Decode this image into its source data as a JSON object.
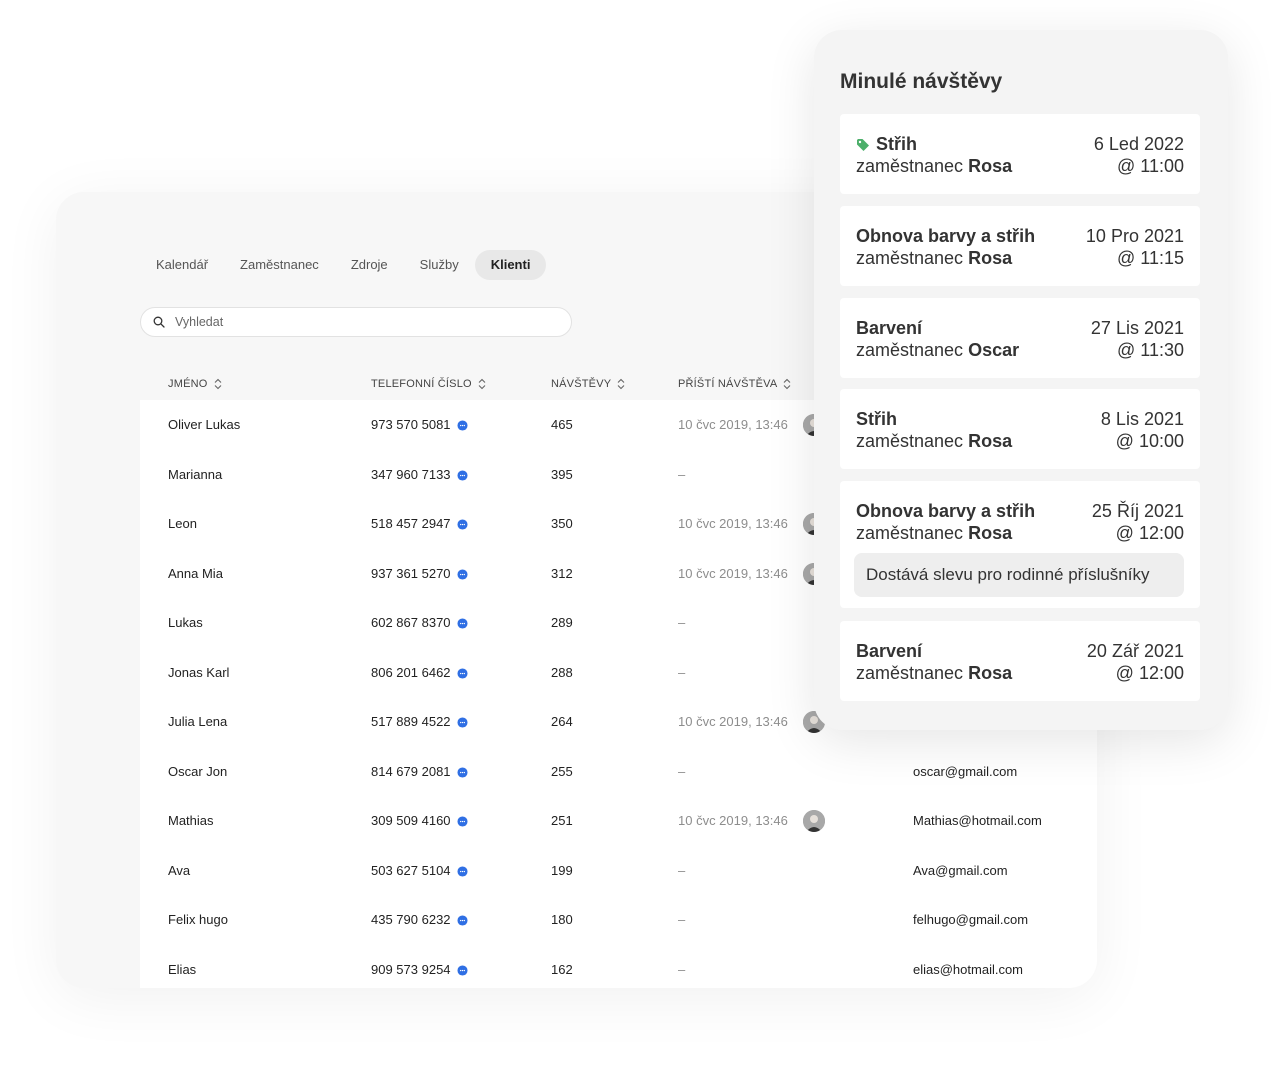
{
  "nav": {
    "tabs": [
      {
        "label": "Kalendář"
      },
      {
        "label": "Zaměstnanec"
      },
      {
        "label": "Zdroje"
      },
      {
        "label": "Služby"
      },
      {
        "label": "Klienti"
      }
    ],
    "active_tab": "Klienti"
  },
  "search": {
    "placeholder": "Vyhledat",
    "value": ""
  },
  "table": {
    "columns": [
      "JMÉNO",
      "TELEFONNÍ ČÍSLO",
      "NÁVŠTĚVY",
      "PŘÍŠTÍ NÁVŠTĚVA"
    ],
    "rows": [
      {
        "name": "Oliver Lukas",
        "phone": "973 570 5081",
        "visits": "465",
        "next": "10 čvc 2019, 13:46",
        "email": ""
      },
      {
        "name": "Marianna",
        "phone": "347 960 7133",
        "visits": "395",
        "next": "–",
        "email": ""
      },
      {
        "name": "Leon",
        "phone": "518 457 2947",
        "visits": "350",
        "next": "10 čvc 2019, 13:46",
        "email": ""
      },
      {
        "name": "Anna Mia",
        "phone": "937 361 5270",
        "visits": "312",
        "next": "10 čvc 2019, 13:46",
        "email": ""
      },
      {
        "name": "Lukas",
        "phone": "602 867 8370",
        "visits": "289",
        "next": "–",
        "email": ""
      },
      {
        "name": "Jonas Karl",
        "phone": "806 201 6462",
        "visits": "288",
        "next": "–",
        "email": ""
      },
      {
        "name": "Julia Lena",
        "phone": "517 889 4522",
        "visits": "264",
        "next": "10 čvc 2019, 13:46",
        "email": ""
      },
      {
        "name": "Oscar Jon",
        "phone": "814 679 2081",
        "visits": "255",
        "next": "–",
        "email": "oscar@gmail.com"
      },
      {
        "name": "Mathias",
        "phone": "309 509 4160",
        "visits": "251",
        "next": "10 čvc 2019, 13:46",
        "email": "Mathias@hotmail.com"
      },
      {
        "name": "Ava",
        "phone": "503 627 5104",
        "visits": "199",
        "next": "–",
        "email": "Ava@gmail.com"
      },
      {
        "name": "Felix hugo",
        "phone": "435 790 6232",
        "visits": "180",
        "next": "–",
        "email": "felhugo@gmail.com"
      },
      {
        "name": "Elias",
        "phone": "909 573 9254",
        "visits": "162",
        "next": "–",
        "email": "elias@hotmail.com"
      }
    ]
  },
  "past_visits": {
    "title": "Minulé návštěvy",
    "items": [
      {
        "service": "Střih",
        "staff_prefix": "zaměstnanec",
        "staff": "Rosa",
        "date": "6 Led 2022",
        "time": "@ 11:00",
        "tag": true,
        "note": ""
      },
      {
        "service": "Obnova barvy a střih",
        "staff_prefix": "zaměstnanec",
        "staff": "Rosa",
        "date": "10 Pro 2021",
        "time": "@ 11:15",
        "tag": false,
        "note": ""
      },
      {
        "service": "Barvení",
        "staff_prefix": "zaměstnanec",
        "staff": "Oscar",
        "date": "27 Lis 2021",
        "time": "@ 11:30",
        "tag": false,
        "note": ""
      },
      {
        "service": "Střih",
        "staff_prefix": "zaměstnanec",
        "staff": "Rosa",
        "date": "8 Lis 2021",
        "time": "@ 10:00",
        "tag": false,
        "note": ""
      },
      {
        "service": "Obnova barvy a střih",
        "staff_prefix": "zaměstnanec",
        "staff": "Rosa",
        "date": "25 Říj 2021",
        "time": "@ 12:00",
        "tag": false,
        "note": "Dostává slevu pro rodinné příslušníky"
      },
      {
        "service": "Barvení",
        "staff_prefix": "zaměstnanec",
        "staff": "Rosa",
        "date": "20 Zář 2021",
        "time": "@ 12:00",
        "tag": false,
        "note": ""
      }
    ]
  },
  "colors": {
    "accent": "#2f6fe4",
    "tag": "#4caf6a",
    "panel_bg": "#f4f4f4",
    "page_bg": "#f7f7f7"
  },
  "icons": {
    "search": "search-icon",
    "sort": "sort-icon",
    "chat": "chat-icon",
    "tag": "tag-icon"
  }
}
